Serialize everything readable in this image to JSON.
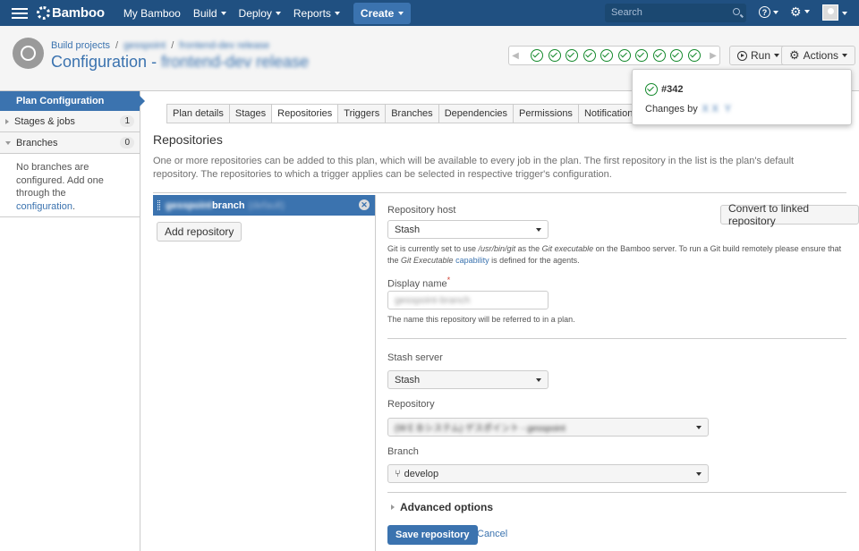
{
  "topbar": {
    "logo": "Bamboo",
    "nav": [
      "My Bamboo",
      "Build",
      "Deploy",
      "Reports"
    ],
    "create": "Create",
    "search_placeholder": "Search",
    "help": "?"
  },
  "header": {
    "breadcrumb_root": "Build projects",
    "breadcrumb_project": "gesspoint",
    "breadcrumb_plan": "frontend-dev release",
    "title_prefix": "Configuration -",
    "title_plan": "frontend-dev release",
    "run": "Run",
    "actions": "Actions",
    "build_statuses": [
      "success",
      "success",
      "success",
      "success",
      "success",
      "success",
      "success",
      "success",
      "success",
      "success"
    ]
  },
  "popup": {
    "build": "#342",
    "changes_label": "Changes by",
    "changes_user": "ＸＸ Ｙ"
  },
  "sidebar": {
    "active": "Plan Configuration",
    "stages": {
      "label": "Stages & jobs",
      "count": "1"
    },
    "branches": {
      "label": "Branches",
      "count": "0"
    },
    "no_branch_text": "No branches are configured. Add one through the",
    "config_link": "configuration",
    "period": "."
  },
  "tabs": [
    "Plan details",
    "Stages",
    "Repositories",
    "Triggers",
    "Branches",
    "Dependencies",
    "Permissions",
    "Notifications"
  ],
  "main": {
    "heading": "Repositories",
    "desc": "One or more repositories can be added to this plan, which will be available to every job in the plan. The first repository in the list is the plan's default repository. The repositories to which a trigger applies can be selected in respective trigger's configuration.",
    "repo_name_blur": "gesspoint",
    "repo_name": "branch",
    "repo_default": "(default)",
    "add_repo": "Add repository",
    "convert": "Convert to linked repository"
  },
  "form": {
    "host_label": "Repository host",
    "host_value": "Stash",
    "git_help_1": "Git is currently set to use ",
    "git_path": "/usr/bin/git",
    "git_help_2": " as the ",
    "git_exec": "Git executable",
    "git_help_3": " on the Bamboo server. To run a Git build remotely please ensure that the ",
    "git_exec2": "Git Executable",
    "git_cap": "capability",
    "git_help_4": " is defined for the agents.",
    "display_label": "Display name",
    "required": "*",
    "display_value": "gesspoint-branch",
    "display_help": "The name this repository will be referred to in a plan.",
    "server_label": "Stash server",
    "server_value": "Stash",
    "repo_label": "Repository",
    "repo_value": "(ＷＥＢシステム) ゲスポイント - gesspoint",
    "branch_label": "Branch",
    "branch_value": "develop",
    "advanced": "Advanced options",
    "save": "Save repository",
    "cancel": "Cancel"
  },
  "colors": {
    "brand": "#205081",
    "accent": "#3b73af",
    "success": "#14892c"
  }
}
